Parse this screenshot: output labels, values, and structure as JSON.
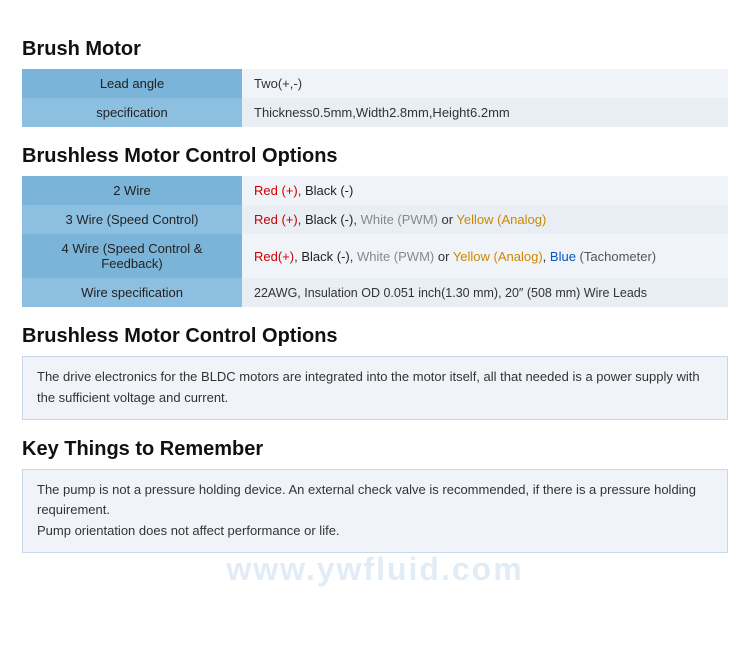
{
  "brushMotor": {
    "title": "Brush Motor",
    "rows": [
      {
        "label": "Lead angle",
        "value": "Two(+,-)"
      },
      {
        "label": "specification",
        "value": "Thickness0.5mm,Width2.8mm,Height6.2mm"
      }
    ]
  },
  "brushlessOptions": {
    "title": "Brushless Motor Control Options",
    "rows": [
      {
        "label": "2 Wire",
        "value": "Red (+), Black (-)",
        "type": "colored_simple"
      },
      {
        "label": "3 Wire (Speed Control)",
        "value": "Red (+), Black (-), White (PWM) or Yellow (Analog)",
        "type": "colored_3wire"
      },
      {
        "label": "4 Wire (Speed Control & Feedback)",
        "value": "Red(+), Black (-), White (PWM) or Yellow (Analog), Blue (Tachometer)",
        "type": "colored_4wire"
      },
      {
        "label": "Wire specification",
        "value": "22AWG, Insulation OD 0.051 inch(1.30 mm), 20″ (508 mm) Wire Leads",
        "type": "wire_spec"
      }
    ]
  },
  "brushlessMotorDesc": {
    "title": "Brushless Motor Control Options",
    "text": "The drive electronics for the BLDC motors are integrated into the motor itself, all that needed is a power supply with the sufficient voltage and current."
  },
  "keyThings": {
    "title": "Key Things to Remember",
    "lines": [
      "The pump is not a pressure holding device. An external check valve is recommended, if there is a pressure holding requirement.",
      "Pump orientation does not affect performance or life."
    ]
  },
  "watermark": "www.ywfluid.com"
}
